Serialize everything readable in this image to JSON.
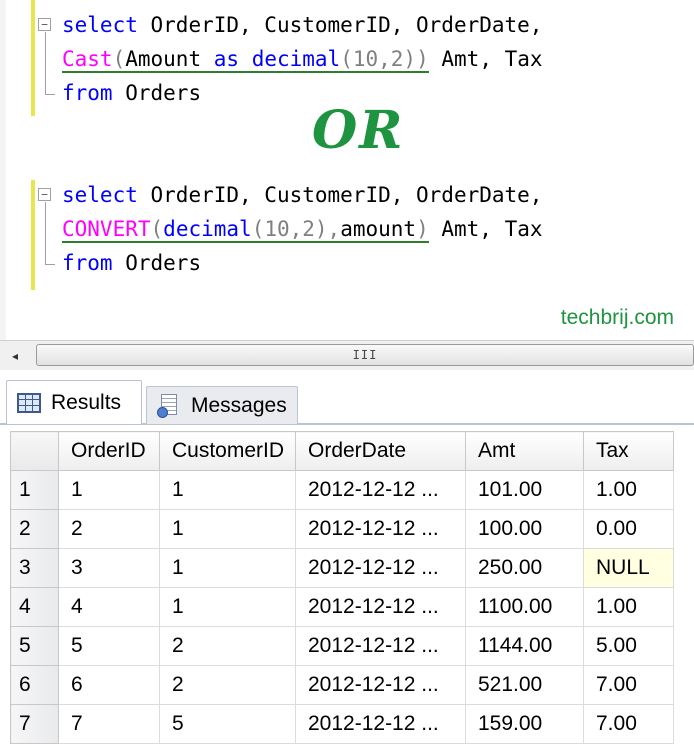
{
  "editor": {
    "query1": {
      "line1": {
        "keyword": "select",
        "columns": "OrderID, CustomerID, OrderDate,"
      },
      "line2": {
        "func": "Cast",
        "paren_open": "(",
        "arg": "Amount",
        "as_kw": "as",
        "type": "decimal",
        "type_args": "(10,2)",
        "paren_close": ")",
        "rest": "Amt, Tax"
      },
      "line3": {
        "keyword": "from",
        "table": "Orders"
      }
    },
    "or_text": "OR",
    "query2": {
      "line1": {
        "keyword": "select",
        "columns": "OrderID, CustomerID, OrderDate,"
      },
      "line2": {
        "func": "CONVERT",
        "paren_open": "(",
        "type": "decimal",
        "type_args": "(10,2),",
        "arg": "amount",
        "paren_close": ")",
        "rest": "Amt, Tax"
      },
      "line3": {
        "keyword": "from",
        "table": "Orders"
      }
    },
    "watermark": "techbrij.com",
    "collapse_glyph": "−"
  },
  "scrollbar": {
    "left_arrow": "◂",
    "grip": "III"
  },
  "tabs": [
    {
      "label": "Results",
      "icon": "grid-icon",
      "selected": true
    },
    {
      "label": "Messages",
      "icon": "messages-icon",
      "selected": false
    }
  ],
  "results": {
    "columns": [
      "OrderID",
      "CustomerID",
      "OrderDate",
      "Amt",
      "Tax"
    ],
    "rows": [
      {
        "n": "1",
        "cells": [
          "1",
          "1",
          "2012-12-12 ...",
          "101.00",
          "1.00"
        ]
      },
      {
        "n": "2",
        "cells": [
          "2",
          "1",
          "2012-12-12 ...",
          "100.00",
          "0.00"
        ]
      },
      {
        "n": "3",
        "cells": [
          "3",
          "1",
          "2012-12-12 ...",
          "250.00",
          "NULL"
        ]
      },
      {
        "n": "4",
        "cells": [
          "4",
          "1",
          "2012-12-12 ...",
          "1100.00",
          "1.00"
        ]
      },
      {
        "n": "5",
        "cells": [
          "5",
          "2",
          "2012-12-12 ...",
          "1144.00",
          "5.00"
        ]
      },
      {
        "n": "6",
        "cells": [
          "6",
          "2",
          "2012-12-12 ...",
          "521.00",
          "7.00"
        ]
      },
      {
        "n": "7",
        "cells": [
          "7",
          "5",
          "2012-12-12 ...",
          "159.00",
          "7.00"
        ]
      }
    ]
  },
  "colors": {
    "keyword": "#0000ff",
    "function": "#ff00ff",
    "operator": "#808080",
    "or_green": "#1e9440",
    "null_cell": "#ffffe1"
  }
}
